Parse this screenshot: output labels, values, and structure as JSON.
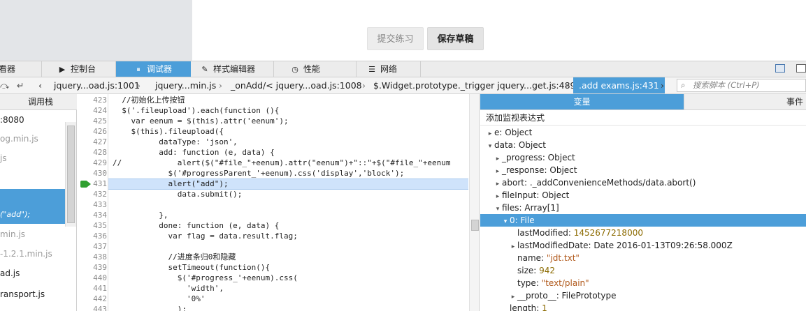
{
  "page_buttons": {
    "submit": "提交练习",
    "save_draft": "保存草稿"
  },
  "devtools_tabs": [
    {
      "label": "查看器",
      "icon": "inspector-icon"
    },
    {
      "label": "控制台",
      "icon": "console-icon"
    },
    {
      "label": "调试器",
      "icon": "debugger-icon"
    },
    {
      "label": "样式编辑器",
      "icon": "style-editor-icon"
    },
    {
      "label": "性能",
      "icon": "performance-icon"
    },
    {
      "label": "网络",
      "icon": "network-icon"
    }
  ],
  "breadcrumb": [
    "jquery...oad.js:1001",
    "jquery...min.js",
    "_onAdd/< jquery...oad.js:1008",
    "$.Widget.prototype._trigger jquery...get.js:489",
    ".add exams.js:431"
  ],
  "search": {
    "placeholder": "搜索脚本 (Ctrl+P)"
  },
  "left_pane": {
    "header": "调用栈",
    "items": [
      {
        "text": ":8080",
        "dim": false
      },
      {
        "text": "og.min.js",
        "dim": true
      },
      {
        "text": "js",
        "dim": true
      },
      {
        "text": "",
        "dim": false
      },
      {
        "text": "min.js",
        "dim": true
      },
      {
        "text": "-1.2.1.min.js",
        "dim": true
      },
      {
        "text": "ad.js",
        "dim": false
      },
      {
        "text": "ransport.js",
        "dim": false
      }
    ],
    "selected_text": "(\"add\");"
  },
  "source": {
    "highlight_line": 431,
    "breakpoint_line": 431,
    "lines": [
      {
        "n": "423",
        "code": "  //初始化上传按钮"
      },
      {
        "n": "424",
        "code": "  $('.fileupload').each(function (){"
      },
      {
        "n": "425",
        "code": "    var eenum = $(this).attr('eenum');"
      },
      {
        "n": "426",
        "code": "    $(this).fileupload({"
      },
      {
        "n": "427",
        "code": "          dataType: 'json',"
      },
      {
        "n": "428",
        "code": "          add: function (e, data) {"
      },
      {
        "n": "429",
        "code": "//            alert($(\"#file_\"+eenum).attr(\"eenum\")+\"::\"+$(\"#file_\"+eenum"
      },
      {
        "n": "430",
        "code": "            $('#progressParent_'+eenum).css('display','block');"
      },
      {
        "n": "431",
        "code": "            alert(\"add\");"
      },
      {
        "n": "432",
        "code": "              data.submit();"
      },
      {
        "n": "433",
        "code": ""
      },
      {
        "n": "434",
        "code": "          },"
      },
      {
        "n": "435",
        "code": "          done: function (e, data) {"
      },
      {
        "n": "436",
        "code": "            var flag = data.result.flag;"
      },
      {
        "n": "437",
        "code": ""
      },
      {
        "n": "438",
        "code": "            //进度条归0和隐藏"
      },
      {
        "n": "439",
        "code": "            setTimeout(function(){"
      },
      {
        "n": "440",
        "code": "              $('#progress_'+eenum).css("
      },
      {
        "n": "441",
        "code": "                'width',"
      },
      {
        "n": "442",
        "code": "                '0%'"
      },
      {
        "n": "443",
        "code": "              );"
      }
    ]
  },
  "variables": {
    "tabs": [
      "变量",
      "事件"
    ],
    "add_watch": "添加监视表达式",
    "rows": [
      {
        "indent": 0,
        "tw": "▸",
        "key": "e",
        "val": "Object",
        "vtype": "k"
      },
      {
        "indent": 0,
        "tw": "▾",
        "key": "data",
        "val": "Object",
        "vtype": "k"
      },
      {
        "indent": 1,
        "tw": "▸",
        "key": "_progress",
        "val": "Object",
        "vtype": "k"
      },
      {
        "indent": 1,
        "tw": "▸",
        "key": "_response",
        "val": "Object",
        "vtype": "k"
      },
      {
        "indent": 1,
        "tw": "▸",
        "key": "abort",
        "val": "._addConvenienceMethods/data.abort()",
        "vtype": "k"
      },
      {
        "indent": 1,
        "tw": "▸",
        "key": "fileInput",
        "val": "Object",
        "vtype": "k"
      },
      {
        "indent": 1,
        "tw": "▾",
        "key": "files",
        "val": "Array[1]",
        "vtype": "k"
      },
      {
        "indent": 2,
        "tw": "▾",
        "key": "0",
        "val": "File",
        "vtype": "k",
        "sel": true
      },
      {
        "indent": 3,
        "tw": "",
        "key": "lastModified",
        "val": "1452677218000",
        "vtype": "num"
      },
      {
        "indent": 3,
        "tw": "▸",
        "key": "lastModifiedDate",
        "val": "Date 2016-01-13T09:26:58.000Z",
        "vtype": "k"
      },
      {
        "indent": 3,
        "tw": "",
        "key": "name",
        "val": "\"jdt.txt\"",
        "vtype": "str"
      },
      {
        "indent": 3,
        "tw": "",
        "key": "size",
        "val": "942",
        "vtype": "num"
      },
      {
        "indent": 3,
        "tw": "",
        "key": "type",
        "val": "\"text/plain\"",
        "vtype": "str"
      },
      {
        "indent": 3,
        "tw": "▸",
        "key": "__proto__",
        "val": "FilePrototype",
        "vtype": "k"
      },
      {
        "indent": 2,
        "tw": "",
        "key": "length",
        "val": "1",
        "vtype": "num"
      }
    ]
  },
  "colors": {
    "accent": "#4c9ed9",
    "highlight": "#cfe3fb",
    "breakpoint": "#30a030"
  }
}
